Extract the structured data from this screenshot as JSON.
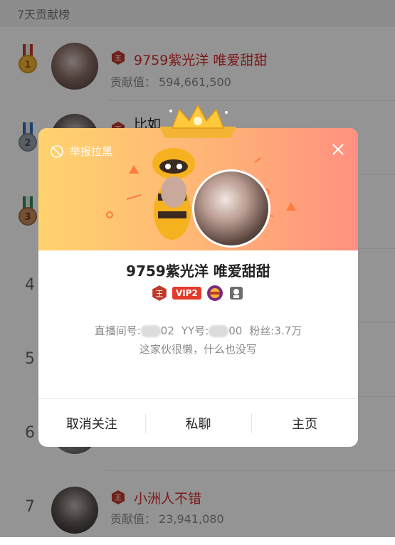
{
  "header": {
    "title": "7天贡献榜"
  },
  "list": {
    "rows": [
      {
        "rank": "",
        "name": "9759紫光洋  唯爱甜甜",
        "contrib_label": "贡献值：",
        "contrib_value": "594,661,500"
      },
      {
        "rank": "",
        "name": "比如",
        "contrib_label": "",
        "contrib_value": ""
      },
      {
        "rank": "",
        "name": "",
        "contrib_label": "",
        "contrib_value": ""
      },
      {
        "rank": "4",
        "name": "",
        "contrib_label": "",
        "contrib_value": ""
      },
      {
        "rank": "5",
        "name": "",
        "contrib_label": "",
        "contrib_value": ""
      },
      {
        "rank": "6",
        "name": "",
        "contrib_label": "",
        "contrib_value": ""
      },
      {
        "rank": "7",
        "name": "小洲人不错",
        "contrib_label": "贡献值：",
        "contrib_value": "23,941,080"
      }
    ]
  },
  "modal": {
    "report_label": "举报拉黑",
    "display_name": "9759紫光洋  唯爱甜甜",
    "badges": {
      "level": "王",
      "vip": "VIP2"
    },
    "stats": {
      "room_label": "直播间号:",
      "room_suffix": "02",
      "yy_label": "YY号:",
      "yy_suffix": "00",
      "fans_label": "粉丝:",
      "fans_value": "3.7万"
    },
    "signature": "这家伙很懒，什么也没写",
    "actions": {
      "unfollow": "取消关注",
      "message": "私聊",
      "homepage": "主页"
    }
  },
  "colors": {
    "accent_red": "#d42d2d",
    "gold": "#f3b436",
    "header_gradient_start": "#ffd36e",
    "header_gradient_end": "#ff9080"
  },
  "icons": [
    "medal-gold-icon",
    "medal-silver-icon",
    "medal-bronze-icon",
    "level-badge-icon",
    "report-block-icon",
    "close-icon",
    "crown-icon",
    "mascot-icon"
  ]
}
